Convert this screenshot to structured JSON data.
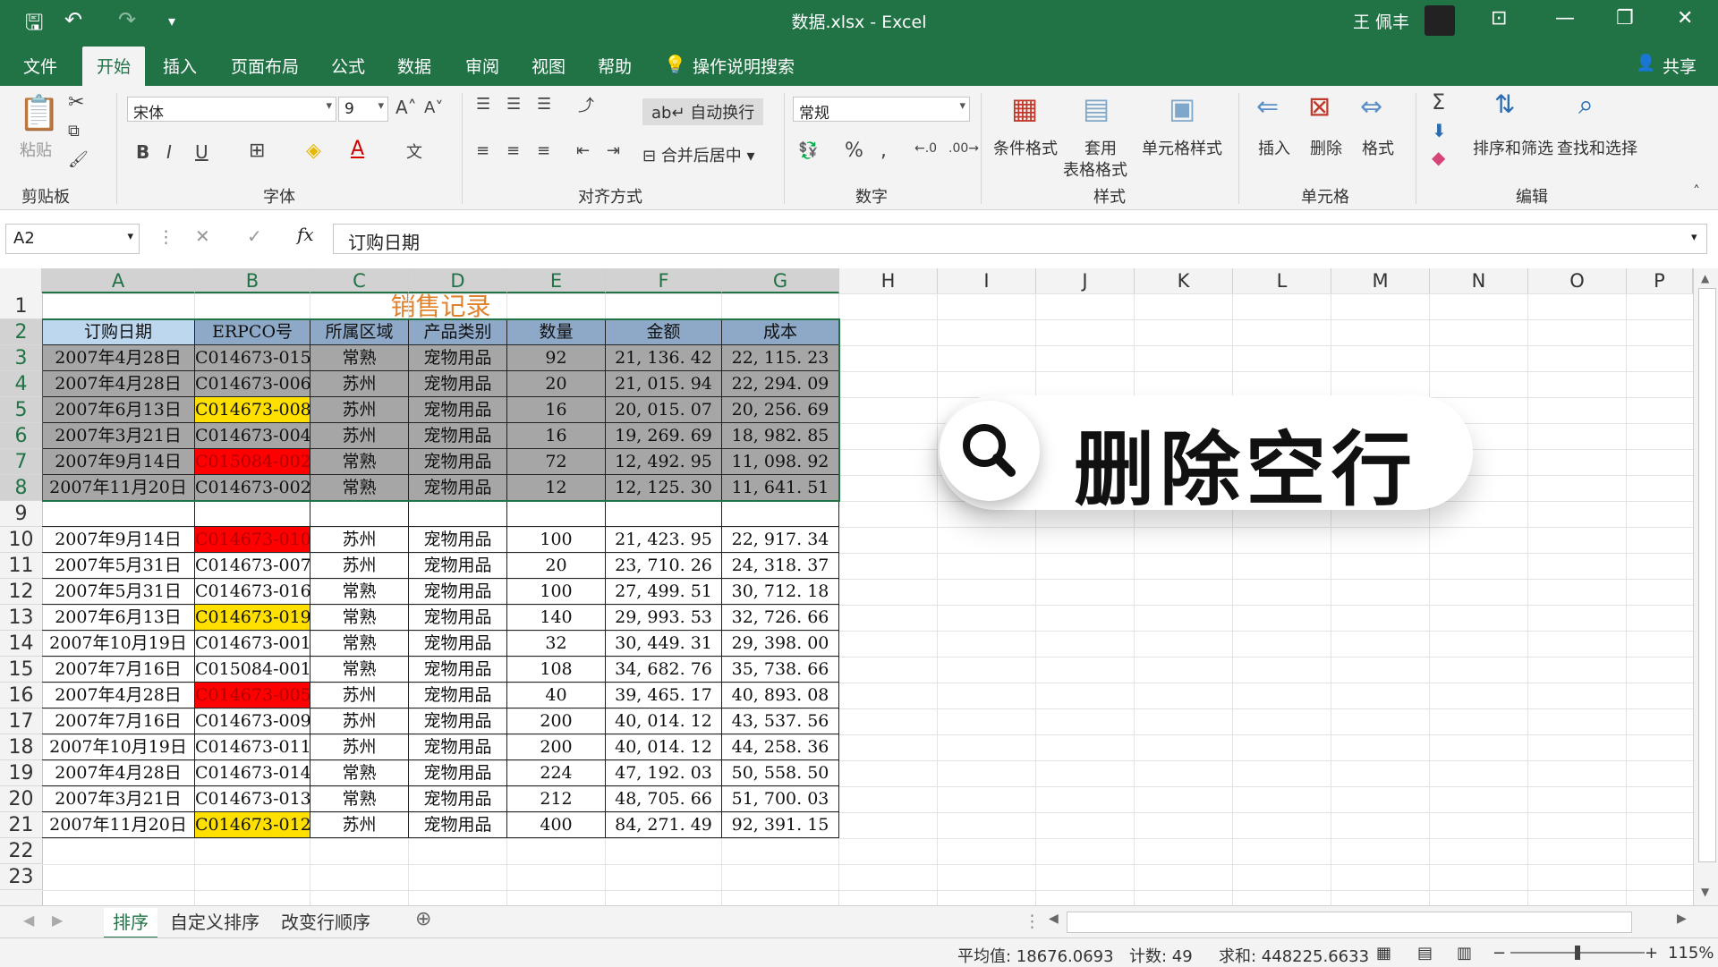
{
  "window": {
    "file_title": "数据.xlsx  -  Excel",
    "user": "王 佩丰"
  },
  "ribbon_tabs": [
    "文件",
    "开始",
    "插入",
    "页面布局",
    "公式",
    "数据",
    "审阅",
    "视图",
    "帮助",
    "操作说明搜索"
  ],
  "share_label": "共享",
  "ribbon": {
    "paste": "粘贴",
    "clipboard": "剪贴板",
    "font_name": "宋体",
    "font_size": "9",
    "font_group": "字体",
    "wrap_text": "自动换行",
    "merge_center": "合并后居中",
    "align_group": "对齐方式",
    "number_format": "常规",
    "number_group": "数字",
    "cond_format": "条件格式",
    "table_format_1": "套用",
    "table_format_2": "表格格式",
    "cell_style": "单元格样式",
    "styles_group": "样式",
    "insert": "插入",
    "delete": "删除",
    "format": "格式",
    "cells_group": "单元格",
    "sort_filter": "排序和筛选",
    "find_select": "查找和选择",
    "edit_group": "编辑"
  },
  "formula_bar": {
    "name_box": "A2",
    "content": "订购日期"
  },
  "columns": [
    "A",
    "B",
    "C",
    "D",
    "E",
    "F",
    "G",
    "H",
    "I",
    "J",
    "K",
    "L",
    "M",
    "N",
    "O",
    "P"
  ],
  "rows": [
    "1",
    "2",
    "3",
    "4",
    "5",
    "6",
    "7",
    "8",
    "9",
    "10",
    "11",
    "12",
    "13",
    "14",
    "15",
    "16",
    "17",
    "18",
    "19",
    "20",
    "21",
    "22",
    "23"
  ],
  "sheet_title": "销售记录",
  "table_headers": [
    "订购日期",
    "ERPCO号",
    "所属区域",
    "产品类别",
    "数量",
    "金额",
    "成本"
  ],
  "table_rows": [
    {
      "row": 3,
      "cells": [
        "2007年4月28日",
        "C014673-015",
        "常熟",
        "宠物用品",
        "92",
        "21, 136. 42",
        "22, 115. 23"
      ],
      "hl": ""
    },
    {
      "row": 4,
      "cells": [
        "2007年4月28日",
        "C014673-006",
        "苏州",
        "宠物用品",
        "20",
        "21, 015. 94",
        "22, 294. 09"
      ],
      "hl": ""
    },
    {
      "row": 5,
      "cells": [
        "2007年6月13日",
        "C014673-008",
        "苏州",
        "宠物用品",
        "16",
        "20, 015. 07",
        "20, 256. 69"
      ],
      "hl": "yellow"
    },
    {
      "row": 6,
      "cells": [
        "2007年3月21日",
        "C014673-004",
        "苏州",
        "宠物用品",
        "16",
        "19, 269. 69",
        "18, 982. 85"
      ],
      "hl": ""
    },
    {
      "row": 7,
      "cells": [
        "2007年9月14日",
        "C015084-002",
        "常熟",
        "宠物用品",
        "72",
        "12, 492. 95",
        "11, 098. 92"
      ],
      "hl": "red"
    },
    {
      "row": 8,
      "cells": [
        "2007年11月20日",
        "C014673-002",
        "常熟",
        "宠物用品",
        "12",
        "12, 125. 30",
        "11, 641. 51"
      ],
      "hl": ""
    },
    {
      "row": 10,
      "cells": [
        "2007年9月14日",
        "C014673-010",
        "苏州",
        "宠物用品",
        "100",
        "21, 423. 95",
        "22, 917. 34"
      ],
      "hl": "red"
    },
    {
      "row": 11,
      "cells": [
        "2007年5月31日",
        "C014673-007",
        "苏州",
        "宠物用品",
        "20",
        "23, 710. 26",
        "24, 318. 37"
      ],
      "hl": ""
    },
    {
      "row": 12,
      "cells": [
        "2007年5月31日",
        "C014673-016",
        "常熟",
        "宠物用品",
        "100",
        "27, 499. 51",
        "30, 712. 18"
      ],
      "hl": ""
    },
    {
      "row": 13,
      "cells": [
        "2007年6月13日",
        "C014673-019",
        "常熟",
        "宠物用品",
        "140",
        "29, 993. 53",
        "32, 726. 66"
      ],
      "hl": "yellow"
    },
    {
      "row": 14,
      "cells": [
        "2007年10月19日",
        "C014673-001",
        "常熟",
        "宠物用品",
        "32",
        "30, 449. 31",
        "29, 398. 00"
      ],
      "hl": ""
    },
    {
      "row": 15,
      "cells": [
        "2007年7月16日",
        "C015084-001",
        "常熟",
        "宠物用品",
        "108",
        "34, 682. 76",
        "35, 738. 66"
      ],
      "hl": ""
    },
    {
      "row": 16,
      "cells": [
        "2007年4月28日",
        "C014673-005",
        "苏州",
        "宠物用品",
        "40",
        "39, 465. 17",
        "40, 893. 08"
      ],
      "hl": "red"
    },
    {
      "row": 17,
      "cells": [
        "2007年7月16日",
        "C014673-009",
        "苏州",
        "宠物用品",
        "200",
        "40, 014. 12",
        "43, 537. 56"
      ],
      "hl": ""
    },
    {
      "row": 18,
      "cells": [
        "2007年10月19日",
        "C014673-011",
        "苏州",
        "宠物用品",
        "200",
        "40, 014. 12",
        "44, 258. 36"
      ],
      "hl": ""
    },
    {
      "row": 19,
      "cells": [
        "2007年4月28日",
        "C014673-014",
        "常熟",
        "宠物用品",
        "224",
        "47, 192. 03",
        "50, 558. 50"
      ],
      "hl": ""
    },
    {
      "row": 20,
      "cells": [
        "2007年3月21日",
        "C014673-013",
        "常熟",
        "宠物用品",
        "212",
        "48, 705. 66",
        "51, 700. 03"
      ],
      "hl": ""
    },
    {
      "row": 21,
      "cells": [
        "2007年11月20日",
        "C014673-012",
        "苏州",
        "宠物用品",
        "400",
        "84, 271. 49",
        "92, 391. 15"
      ],
      "hl": "yellow"
    }
  ],
  "overlay_title": "删除空行",
  "sheet_tabs": [
    "排序",
    "自定义排序",
    "改变行顺序"
  ],
  "status": {
    "average": "平均值: 18676.0693",
    "count": "计数: 49",
    "sum": "求和: 448225.6633",
    "zoom": "115%"
  },
  "colors": {
    "excel_green": "#217346",
    "header_blue": "#8ea9c8",
    "highlight_yellow": "#ffe000",
    "highlight_red": "#ff0000",
    "title_orange": "#e0822b"
  }
}
